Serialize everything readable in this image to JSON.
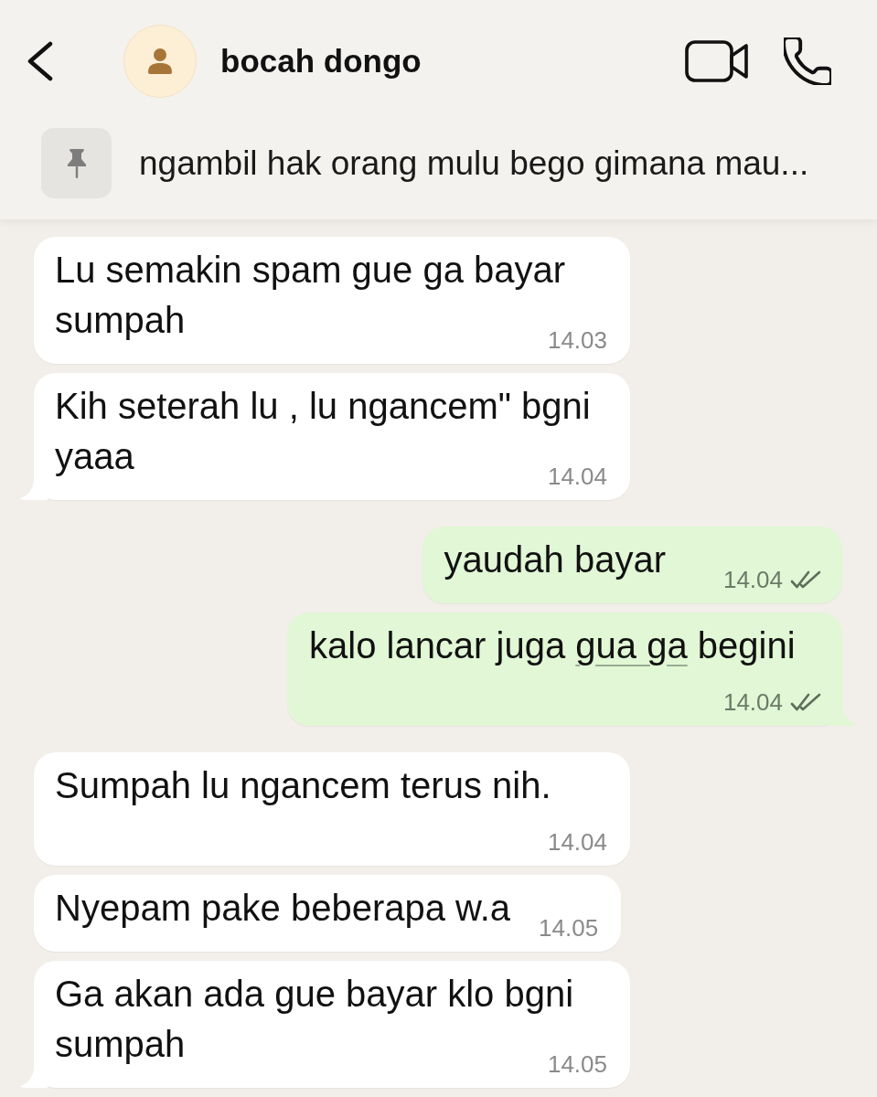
{
  "header": {
    "contact_name": "bocah dongo"
  },
  "pinned_message": {
    "text": "ngambil hak orang mulu bego gimana mau..."
  },
  "messages": [
    {
      "kind": "incoming",
      "text": "Lu semakin spam gue ga bayar sumpah",
      "time": "14.03"
    },
    {
      "kind": "incoming",
      "text": "Kih seterah lu , lu ngancem\" bgni yaaa",
      "time": "14.04"
    },
    {
      "kind": "outgoing",
      "text": "yaudah bayar",
      "time": "14.04",
      "read": false
    },
    {
      "kind": "outgoing",
      "segments": [
        {
          "text": "kalo lancar juga ",
          "underline": false
        },
        {
          "text": "gua ga",
          "underline": true
        },
        {
          "text": " begini",
          "underline": false
        }
      ],
      "time": "14.04",
      "read": false
    },
    {
      "kind": "incoming",
      "text": "Sumpah lu ngancem terus nih.",
      "time": "14.04"
    },
    {
      "kind": "incoming",
      "text": "Nyepam pake beberapa w.a",
      "time": "14.05"
    },
    {
      "kind": "incoming",
      "text": "Ga akan ada gue bayar klo bgni sumpah",
      "time": "14.05"
    }
  ]
}
